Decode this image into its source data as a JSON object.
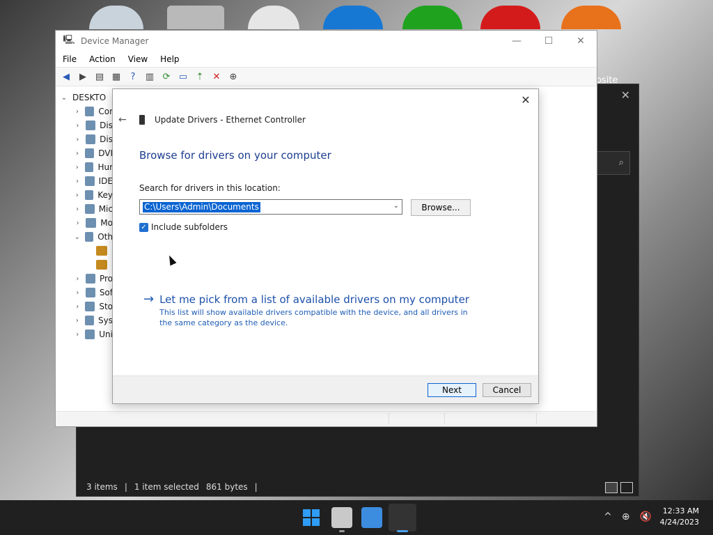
{
  "desktop": {
    "site_label": "osite"
  },
  "explorer": {
    "close_glyph": "✕",
    "search_icon": "⌕",
    "status": {
      "items": "3 items",
      "selected": "1 item selected",
      "size": "861 bytes",
      "sep": "|"
    }
  },
  "device_manager": {
    "title": "Device Manager",
    "menu": [
      "File",
      "Action",
      "View",
      "Help"
    ],
    "window_controls": {
      "minimize": "—",
      "maximize": "☐",
      "close": "✕"
    },
    "tree": [
      {
        "label": "DESKTO",
        "chev": "⌄",
        "level": 0
      },
      {
        "label": "Cor",
        "chev": "›",
        "level": 1
      },
      {
        "label": "Dis",
        "chev": "›",
        "level": 1
      },
      {
        "label": "Dis",
        "chev": "›",
        "level": 1
      },
      {
        "label": "DVI",
        "chev": "›",
        "level": 1
      },
      {
        "label": "Hur",
        "chev": "›",
        "level": 1
      },
      {
        "label": "IDE",
        "chev": "›",
        "level": 1
      },
      {
        "label": "Key",
        "chev": "›",
        "level": 1
      },
      {
        "label": "Mic",
        "chev": "›",
        "level": 1
      },
      {
        "label": "Mo",
        "chev": "›",
        "level": 1
      },
      {
        "label": "Oth",
        "chev": "⌄",
        "level": 1
      },
      {
        "label": "",
        "chev": "",
        "level": 2
      },
      {
        "label": "",
        "chev": "",
        "level": 2
      },
      {
        "label": "Pro",
        "chev": "›",
        "level": 1
      },
      {
        "label": "Sof",
        "chev": "›",
        "level": 1
      },
      {
        "label": "Sto",
        "chev": "›",
        "level": 1
      },
      {
        "label": "Sys",
        "chev": "›",
        "level": 1
      },
      {
        "label": "Uni",
        "chev": "›",
        "level": 1
      }
    ]
  },
  "dialog": {
    "close_glyph": "✕",
    "back_glyph": "←",
    "header": "Update Drivers - Ethernet Controller",
    "heading": "Browse for drivers on your computer",
    "search_label": "Search for drivers in this location:",
    "path_value": "C:\\Users\\Admin\\Documents",
    "dropdown_glyph": "⌄",
    "browse_label": "Browse...",
    "checkbox": {
      "checked": true,
      "mark": "✓",
      "label": "Include subfolders"
    },
    "pick": {
      "arrow": "→",
      "title": "Let me pick from a list of available drivers on my computer",
      "description": "This list will show available drivers compatible with the device, and all drivers in the same category as the device."
    },
    "next_label": "Next",
    "cancel_label": "Cancel"
  },
  "taskbar": {
    "tray_glyphs": {
      "chevron": "^",
      "globe": "⊕",
      "speaker": "🔇"
    },
    "time": "12:33 AM",
    "date": "4/24/2023"
  },
  "colors": {
    "accent": "#0a64d2",
    "heading": "#1c3d8f",
    "link": "#1f5db5",
    "delete": "#d21a1a"
  }
}
